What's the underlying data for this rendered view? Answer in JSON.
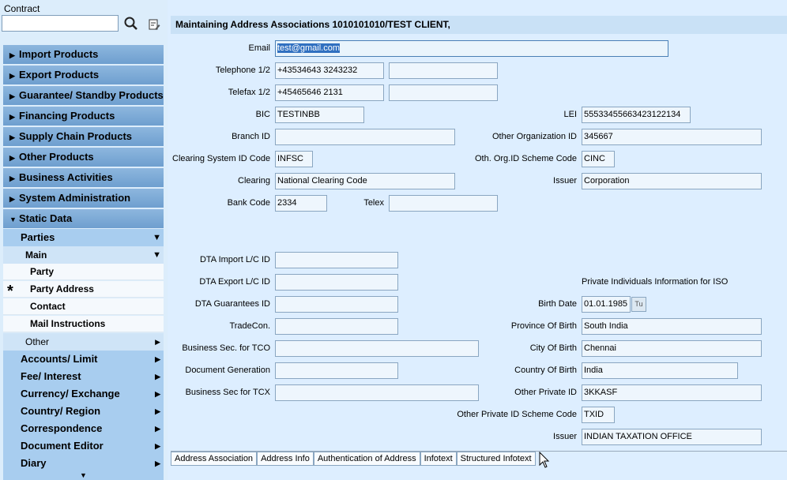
{
  "contract": {
    "label": "Contract",
    "value": ""
  },
  "menu": [
    {
      "label": "Import Products"
    },
    {
      "label": "Export Products"
    },
    {
      "label": "Guarantee/ Standby Products"
    },
    {
      "label": "Financing Products"
    },
    {
      "label": "Supply Chain Products"
    },
    {
      "label": "Other Products"
    },
    {
      "label": "Business Activities"
    },
    {
      "label": "System Administration"
    },
    {
      "label": "Static Data"
    }
  ],
  "static_data": {
    "parties": "Parties",
    "main": "Main",
    "leaves": [
      "Party",
      "Party Address",
      "Contact",
      "Mail Instructions"
    ],
    "other": "Other",
    "more": [
      "Accounts/ Limit",
      "Fee/ Interest",
      "Currency/ Exchange",
      "Country/ Region",
      "Correspondence",
      "Document Editor",
      "Diary"
    ]
  },
  "header": {
    "title": "Maintaining Address Associations 1010101010/TEST CLIENT,"
  },
  "form": {
    "email": {
      "label": "Email",
      "value": "test@gmail.com"
    },
    "telephone": {
      "label": "Telephone 1/2",
      "value1": "+43534643 3243232",
      "value2": ""
    },
    "telefax": {
      "label": "Telefax 1/2",
      "value1": "+45465646 2131",
      "value2": ""
    },
    "bic": {
      "label": "BIC",
      "value": "TESTINBB"
    },
    "lei": {
      "label": "LEI",
      "value": "55533455663423122134"
    },
    "branch_id": {
      "label": "Branch ID",
      "value": ""
    },
    "other_org_id": {
      "label": "Other Organization ID",
      "value": "345667"
    },
    "clearing_system_id": {
      "label": "Clearing System ID Code",
      "value": "INFSC"
    },
    "oth_org_scheme": {
      "label": "Oth. Org.ID Scheme Code",
      "value": "CINC"
    },
    "clearing": {
      "label": "Clearing",
      "value": "National Clearing Code"
    },
    "issuer1": {
      "label": "Issuer",
      "value": "Corporation"
    },
    "bank_code": {
      "label": "Bank Code",
      "value": "2334"
    },
    "telex": {
      "label": "Telex",
      "value": ""
    },
    "dta_import": {
      "label": "DTA Import L/C ID",
      "value": ""
    },
    "dta_export": {
      "label": "DTA Export L/C ID",
      "value": ""
    },
    "private_info": "Private Individuals Information for ISO",
    "dta_guarantees": {
      "label": "DTA Guarantees ID",
      "value": ""
    },
    "birth_date": {
      "label": "Birth Date",
      "value": "01.01.1985"
    },
    "tradecon": {
      "label": "TradeCon.",
      "value": ""
    },
    "province_birth": {
      "label": "Province Of Birth",
      "value": "South India"
    },
    "business_tco": {
      "label": "Business Sec. for TCO",
      "value": ""
    },
    "city_birth": {
      "label": "City Of Birth",
      "value": "Chennai"
    },
    "doc_generation": {
      "label": "Document Generation",
      "value": ""
    },
    "country_birth": {
      "label": "Country Of Birth",
      "value": "India"
    },
    "business_tcx": {
      "label": "Business Sec for TCX",
      "value": ""
    },
    "other_private_id": {
      "label": "Other Private ID",
      "value": "3KKASF"
    },
    "other_private_scheme": {
      "label": "Other Private ID Scheme Code",
      "value": "TXID"
    },
    "issuer2": {
      "label": "Issuer",
      "value": "INDIAN TAXATION OFFICE"
    }
  },
  "tabs": [
    "Address Association",
    "Address Info",
    "Authentication of Address",
    "Infotext",
    "Structured Infotext"
  ]
}
